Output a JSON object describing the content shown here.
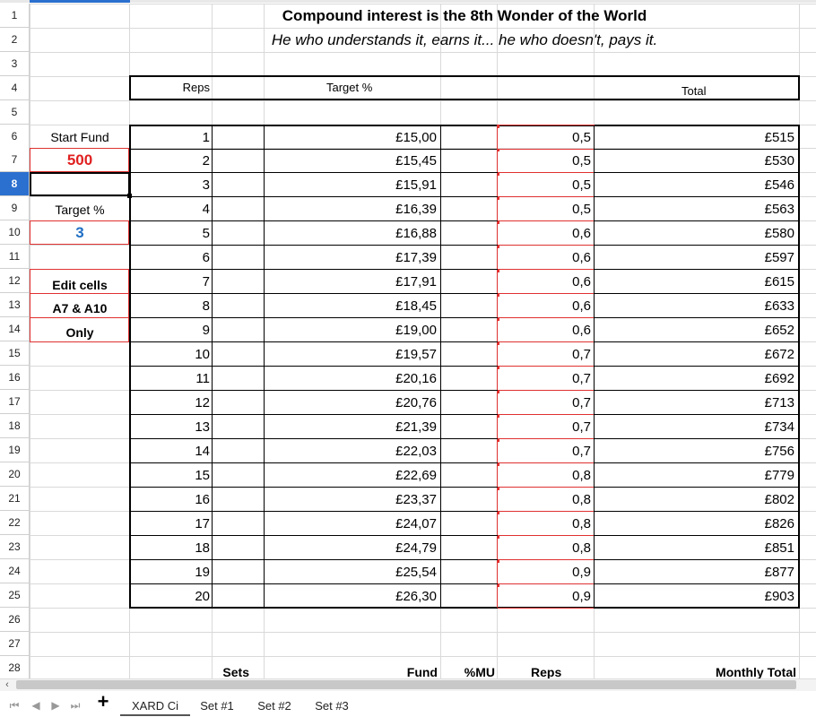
{
  "title": "Compound interest is the 8th Wonder of the World",
  "subtitle": "He who understands it, earns it... he who doesn't, pays it.",
  "header_row": {
    "reps": "Reps",
    "target": "Target %",
    "total": "Total"
  },
  "sidebar": {
    "start_fund_label": "Start Fund",
    "start_fund_value": "500",
    "target_label": "Target %",
    "target_value": "3",
    "note_line1": "Edit cells",
    "note_line2": "A7 & A10",
    "note_line3": "Only"
  },
  "rows": [
    {
      "rep": "1",
      "target": "£15,00",
      "ratio": "0,5",
      "total": "£515"
    },
    {
      "rep": "2",
      "target": "£15,45",
      "ratio": "0,5",
      "total": "£530"
    },
    {
      "rep": "3",
      "target": "£15,91",
      "ratio": "0,5",
      "total": "£546"
    },
    {
      "rep": "4",
      "target": "£16,39",
      "ratio": "0,5",
      "total": "£563"
    },
    {
      "rep": "5",
      "target": "£16,88",
      "ratio": "0,6",
      "total": "£580"
    },
    {
      "rep": "6",
      "target": "£17,39",
      "ratio": "0,6",
      "total": "£597"
    },
    {
      "rep": "7",
      "target": "£17,91",
      "ratio": "0,6",
      "total": "£615"
    },
    {
      "rep": "8",
      "target": "£18,45",
      "ratio": "0,6",
      "total": "£633"
    },
    {
      "rep": "9",
      "target": "£19,00",
      "ratio": "0,6",
      "total": "£652"
    },
    {
      "rep": "10",
      "target": "£19,57",
      "ratio": "0,7",
      "total": "£672"
    },
    {
      "rep": "11",
      "target": "£20,16",
      "ratio": "0,7",
      "total": "£692"
    },
    {
      "rep": "12",
      "target": "£20,76",
      "ratio": "0,7",
      "total": "£713"
    },
    {
      "rep": "13",
      "target": "£21,39",
      "ratio": "0,7",
      "total": "£734"
    },
    {
      "rep": "14",
      "target": "£22,03",
      "ratio": "0,7",
      "total": "£756"
    },
    {
      "rep": "15",
      "target": "£22,69",
      "ratio": "0,8",
      "total": "£779"
    },
    {
      "rep": "16",
      "target": "£23,37",
      "ratio": "0,8",
      "total": "£802"
    },
    {
      "rep": "17",
      "target": "£24,07",
      "ratio": "0,8",
      "total": "£826"
    },
    {
      "rep": "18",
      "target": "£24,79",
      "ratio": "0,8",
      "total": "£851"
    },
    {
      "rep": "19",
      "target": "£25,54",
      "ratio": "0,9",
      "total": "£877"
    },
    {
      "rep": "20",
      "target": "£26,30",
      "ratio": "0,9",
      "total": "£903"
    }
  ],
  "row28": {
    "sets": "Sets",
    "fund": "Fund",
    "mu": "%MU",
    "reps": "Reps",
    "monthly_total": "Monthly Total"
  },
  "row_numbers": [
    "1",
    "2",
    "3",
    "4",
    "5",
    "6",
    "7",
    "8",
    "9",
    "10",
    "11",
    "12",
    "13",
    "14",
    "15",
    "16",
    "17",
    "18",
    "19",
    "20",
    "21",
    "22",
    "23",
    "24",
    "25",
    "26",
    "27",
    "28"
  ],
  "selected_row": "8",
  "tabs": [
    "XARD Ci",
    "Set #1",
    "Set #2",
    "Set #3"
  ],
  "active_tab": "XARD Ci",
  "add_sheet_label": "+",
  "colors": {
    "red": "#e02020",
    "blue": "#1f6fc4",
    "selected_header": "#2b6fcf",
    "red_border": "#e03030"
  }
}
